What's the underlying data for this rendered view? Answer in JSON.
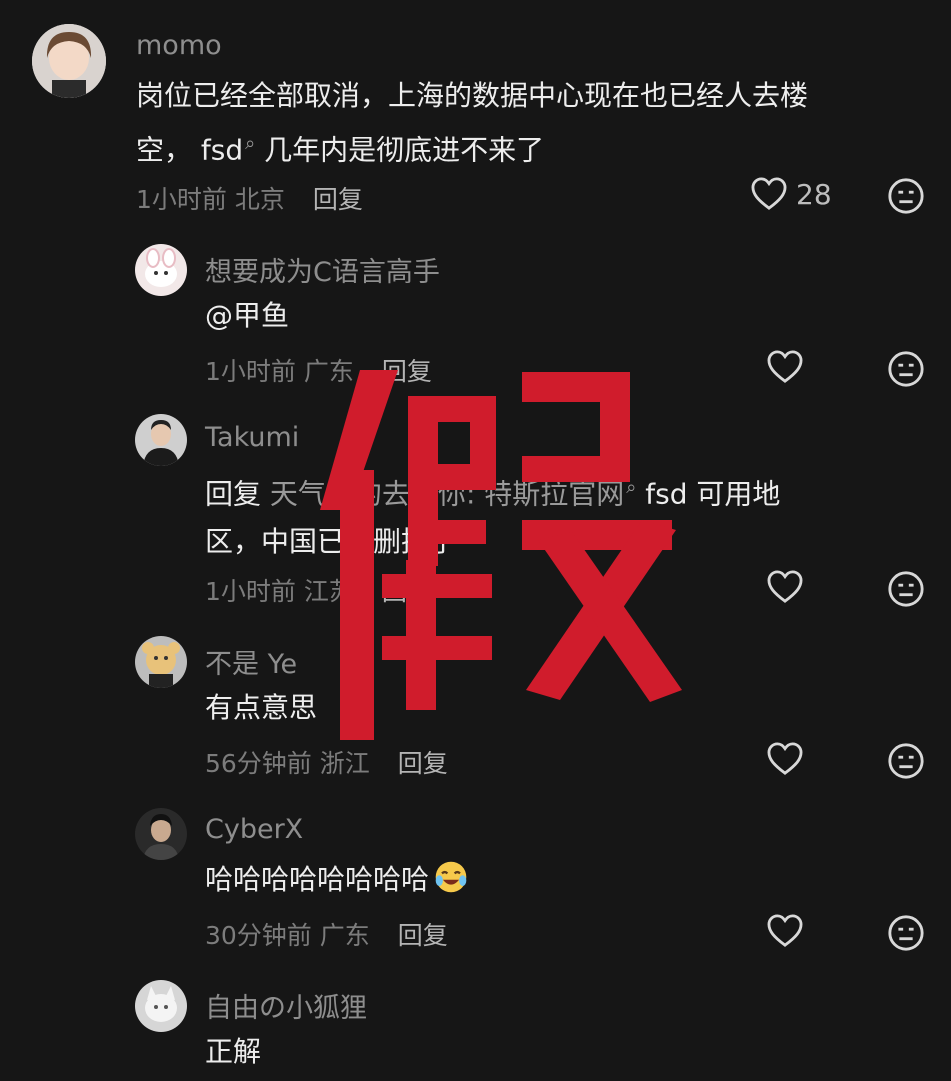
{
  "comments": [
    {
      "user": "momo",
      "text_lines": [
        "岗位已经全部取消，上海的数据中心现在也已经人去楼",
        "空， fsd",
        " 几年内是彻底进不来了"
      ],
      "time": "1小时前",
      "location": "北京",
      "reply": "回复",
      "likes": "28"
    },
    {
      "user": "想要成为C语言高手",
      "text": "@甲鱼",
      "time": "1小时前",
      "location": "广东",
      "reply": "回复"
    },
    {
      "user": "Takumi",
      "reply_prefix": "回复",
      "mention": "天气好的",
      "mention_rest": "去找你: 特斯拉官网",
      "fsd_text": " fsd 可用地",
      "text_line2": "区，中国已被删掉了",
      "time": "1小时前",
      "location": "江苏",
      "reply": "回复"
    },
    {
      "user": "不是 Ye",
      "text": "有点意思",
      "time": "56分钟前",
      "location": "浙江",
      "reply": "回复"
    },
    {
      "user": "CyberX",
      "text": "哈哈哈哈哈哈哈哈",
      "time": "30分钟前",
      "location": "广东",
      "reply": "回复"
    },
    {
      "user": "自由の小狐狸",
      "text": "正解"
    }
  ],
  "stamp_text": "假",
  "icons": {
    "like": "heart-icon",
    "reaction": "neutral-face-icon",
    "search": "search-icon",
    "emoji": "crying-laughing-emoji"
  },
  "colors": {
    "background": "#161616",
    "stamp": "#d01c2c"
  }
}
